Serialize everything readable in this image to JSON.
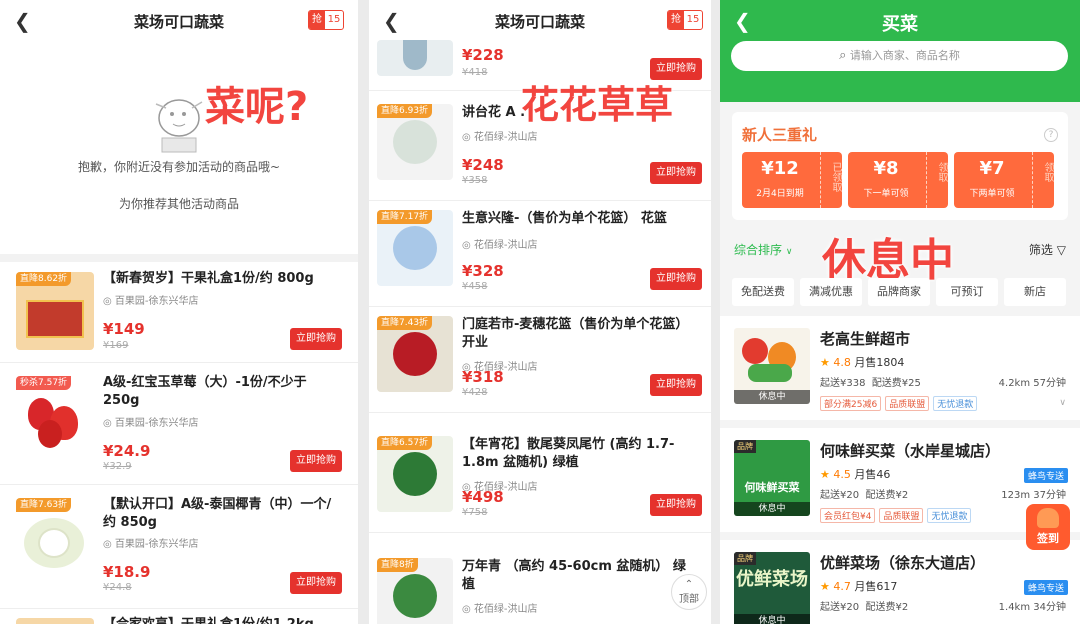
{
  "p1": {
    "title": "菜场可口蔬菜",
    "qiang_l": "抢",
    "qiang_r": "15",
    "overlay": "菜呢?",
    "empty_msg": "抱歉，你附近没有参加活动的商品哦~",
    "recommend": "为你推荐其他活动商品",
    "items": [
      {
        "tag": "直降8.62折",
        "name": "【新春贺岁】干果礼盒1份/约 800g",
        "shop": "百果园-徐东兴华店",
        "price": "¥149",
        "oprice": "¥169",
        "buy": "立即抢购"
      },
      {
        "tag": "秒杀7.57折",
        "name": "A级-红宝玉草莓（大）-1份/不少于250g",
        "shop": "百果园-徐东兴华店",
        "price": "¥24.9",
        "oprice": "¥32.9",
        "buy": "立即抢购"
      },
      {
        "tag": "直降7.63折",
        "name": "【默认开口】A级-泰国椰青（中）一个/约 850g",
        "shop": "百果园-徐东兴华店",
        "price": "¥18.9",
        "oprice": "¥24.8",
        "buy": "立即抢购"
      },
      {
        "tag": "",
        "name": "【合家欢享】干果礼盒1份/约1.2kg",
        "shop": "",
        "price": "",
        "oprice": "",
        "buy": ""
      }
    ]
  },
  "p2": {
    "title": "菜场可口蔬菜",
    "qiang_l": "抢",
    "qiang_r": "15",
    "overlay": "花花草草",
    "top_price": "¥228",
    "top_oprice": "¥418",
    "top_buy": "立即抢购",
    "items": [
      {
        "tag": "直降6.93折",
        "name": "讲台花 A .",
        "shop": "花佰绿-洪山店",
        "price": "¥248",
        "oprice": "¥358",
        "buy": "立即抢购"
      },
      {
        "tag": "直降7.17折",
        "name": "生意兴隆-（售价为单个花篮） 花篮",
        "shop": "花佰绿-洪山店",
        "price": "¥328",
        "oprice": "¥458",
        "buy": "立即抢购"
      },
      {
        "tag": "直降7.43折",
        "name": "门庭若市-麦穗花篮（售价为单个花篮）开业",
        "shop": "花佰绿-洪山店",
        "price": "¥318",
        "oprice": "¥428",
        "buy": "立即抢购"
      },
      {
        "tag": "直降6.57折",
        "name": "【年宵花】散尾葵凤尾竹 (高约 1.7-1.8m 盆随机) 绿植",
        "shop": "花佰绿-洪山店",
        "price": "¥498",
        "oprice": "¥758",
        "buy": "立即抢购"
      },
      {
        "tag": "直降8折",
        "name": "万年青 （高约 45-60cm 盆随机） 绿植",
        "shop": "花佰绿-洪山店",
        "price": "",
        "oprice": "",
        "buy": ""
      }
    ],
    "top_btn": "顶部"
  },
  "p3": {
    "title": "买菜",
    "search_placeholder": "请输入商家、商品名称",
    "newuser_title": "新人三重礼",
    "coupons": [
      {
        "amount": "¥12",
        "desc": "2月4日到期",
        "stamp": "已领取"
      },
      {
        "amount": "¥8",
        "desc": "下一单可领",
        "stamp": "领取"
      },
      {
        "amount": "¥7",
        "desc": "下两单可领",
        "stamp": "领取"
      }
    ],
    "sort": "综合排序",
    "filter": "筛选",
    "overlay": "休息中",
    "chips": [
      "免配送费",
      "满减优惠",
      "品牌商家",
      "可预订",
      "新店"
    ],
    "stores": [
      {
        "name": "老高生鲜超市",
        "rating": "4.8",
        "sales": "月售1804",
        "min": "起送¥338",
        "fee": "配送费¥25",
        "dist": "4.2km 57分钟",
        "status": "休息中",
        "brand": "",
        "badge": "",
        "tags": [
          "部分满25减6",
          "品质联盟",
          "无忧退款"
        ],
        "logo": ""
      },
      {
        "name": "何味鲜买菜（水岸星城店）",
        "rating": "4.5",
        "sales": "月售46",
        "min": "起送¥20",
        "fee": "配送费¥2",
        "dist": "123m 37分钟",
        "status": "休息中",
        "brand": "品牌",
        "badge": "蜂鸟专送",
        "tags": [
          "会员红包¥4",
          "品质联盟",
          "无忧退款"
        ],
        "logo": "何味鲜买菜"
      },
      {
        "name": "优鲜菜场（徐东大道店）",
        "rating": "4.7",
        "sales": "月售617",
        "min": "起送¥20",
        "fee": "配送费¥2",
        "dist": "1.4km 34分钟",
        "status": "休息中",
        "brand": "品牌",
        "badge": "蜂鸟专送",
        "tags": [],
        "logo": "优鲜菜场"
      }
    ],
    "sign": "签到"
  },
  "colors": {
    "accent": "#e5322d",
    "green": "#2dbb4f"
  }
}
